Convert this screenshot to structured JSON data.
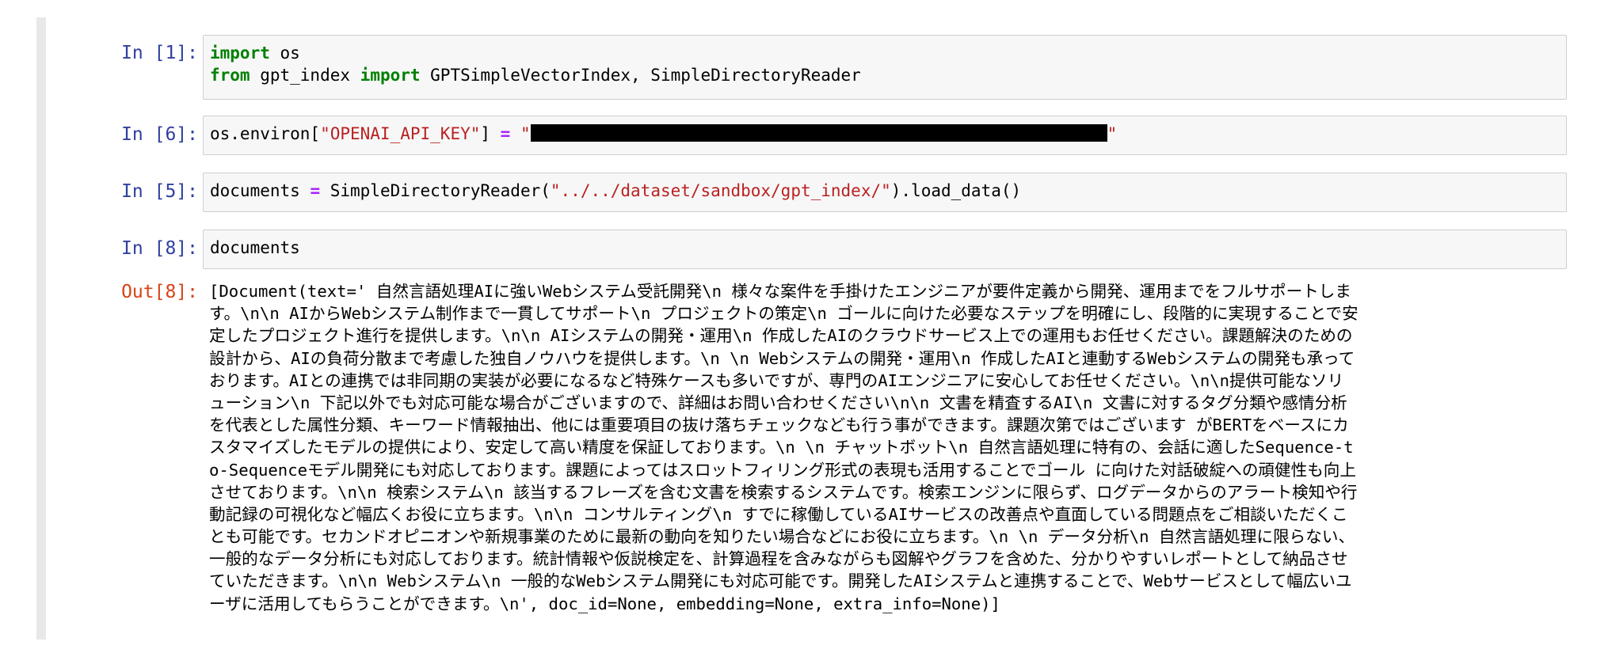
{
  "cells": [
    {
      "prompt": "In [1]:",
      "line1_kw1": "import",
      "line1_rest": " os",
      "line2_kw1": "from",
      "line2_mid": " gpt_index ",
      "line2_kw2": "import",
      "line2_rest": " GPTSimpleVectorIndex, SimpleDirectoryReader"
    },
    {
      "prompt": "In [6]:",
      "code_pre": "os.environ[",
      "code_key": "\"OPENAI_API_KEY\"",
      "code_mid": "] ",
      "code_op": "=",
      "code_str_open": " \"",
      "code_str_close": "\""
    },
    {
      "prompt": "In [5]:",
      "code_pre": "documents ",
      "code_op": "=",
      "code_mid": " SimpleDirectoryReader(",
      "code_str": "\"../../dataset/sandbox/gpt_index/\"",
      "code_post": ").load_data()"
    },
    {
      "prompt": "In [8]:",
      "code": "documents"
    }
  ],
  "output": {
    "prompt": "Out[8]:",
    "lines": [
      "[Document(text=' 自然言語処理AIに強いWebシステム受託開発\\n 様々な案件を手掛けたエンジニアが要件定義から開発、運用までをフルサポートしま",
      "す。\\n\\n AIからWebシステム制作まで一貫してサポート\\n プロジェクトの策定\\n ゴールに向けた必要なステップを明確にし、段階的に実現することで安",
      "定したプロジェクト進行を提供します。\\n\\n AIシステムの開発・運用\\n 作成したAIのクラウドサービス上での運用もお任せください。課題解決のための",
      "設計から、AIの負荷分散まで考慮した独自ノウハウを提供します。\\n \\n Webシステムの開発・運用\\n 作成したAIと連動するWebシステムの開発も承って",
      "おります。AIとの連携では非同期の実装が必要になるなど特殊ケースも多いですが、専門のAIエンジニアに安心してお任せください。\\n\\n提供可能なソリ",
      "ューション\\n 下記以外でも対応可能な場合がございますので、詳細はお問い合わせください\\n\\n 文書を精査するAI\\n 文書に対するタグ分類や感情分析",
      "を代表とした属性分類、キーワード情報抽出、他には重要項目の抜け落ちチェックなども行う事ができます。課題次第ではございます がBERTをベースにカ",
      "スタマイズしたモデルの提供により、安定して高い精度を保証しております。\\n \\n チャットボット\\n 自然言語処理に特有の、会話に適したSequence-t",
      "o-Sequenceモデル開発にも対応しております。課題によってはスロットフィリング形式の表現も活用することでゴール に向けた対話破綻への頑健性も向上",
      "させております。\\n\\n 検索システム\\n 該当するフレーズを含む文書を検索するシステムです。検索エンジンに限らず、ログデータからのアラート検知や行",
      "動記録の可視化など幅広くお役に立ちます。\\n\\n コンサルティング\\n すでに稼働しているAIサービスの改善点や直面している問題点をご相談いただくこ",
      "とも可能です。セカンドオピニオンや新規事業のために最新の動向を知りたい場合などにお役に立ちます。\\n \\n データ分析\\n 自然言語処理に限らない、",
      "一般的なデータ分析にも対応しております。統計情報や仮説検定を、計算過程を含みながらも図解やグラフを含めた、分かりやすいレポートとして納品させ",
      "ていただきます。\\n\\n Webシステム\\n 一般的なWebシステム開発にも対応可能です。開発したAIシステムと連携することで、Webサービスとして幅広いユ",
      "ーザに活用してもらうことができます。\\n', doc_id=None, embedding=None, extra_info=None)]"
    ]
  },
  "colors": {
    "keyword": "#008000",
    "string": "#ba2121",
    "operator": "#aa22ff",
    "in_prompt": "#303f9f",
    "out_prompt": "#d84315"
  }
}
